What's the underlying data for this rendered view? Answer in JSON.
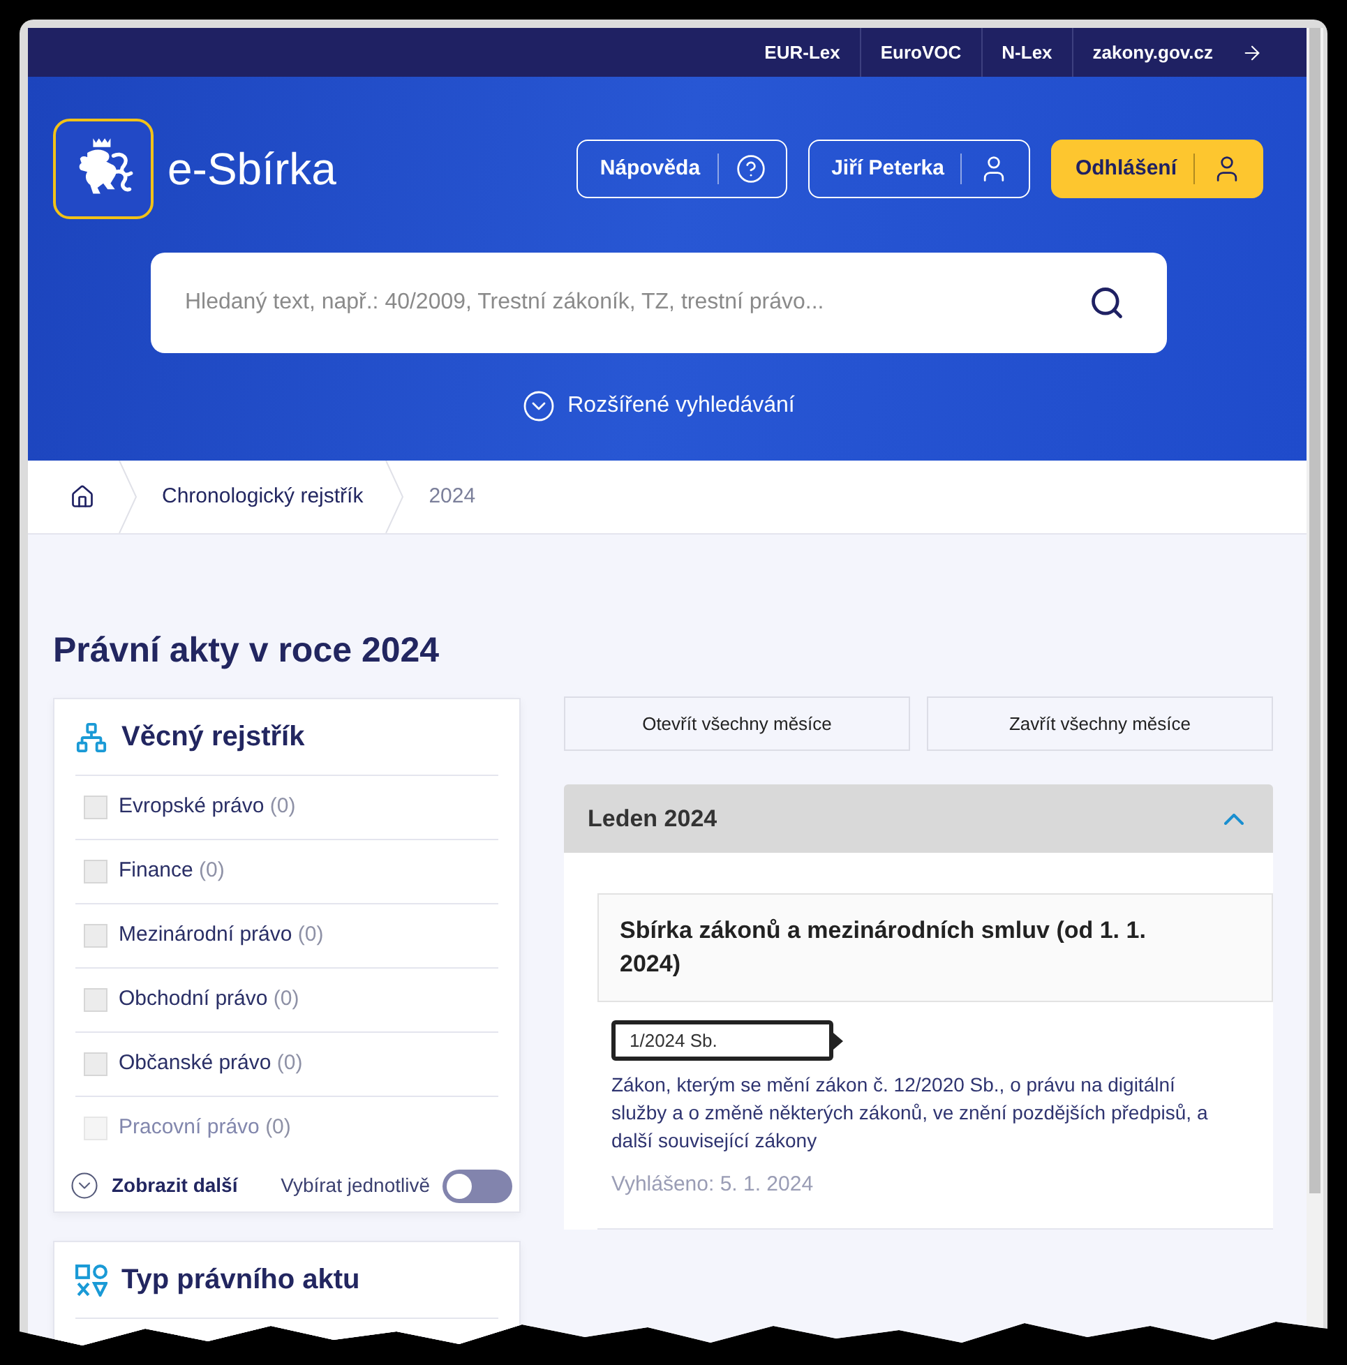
{
  "top_links": [
    {
      "label": "EUR-Lex"
    },
    {
      "label": "EuroVOC"
    },
    {
      "label": "N-Lex"
    },
    {
      "label": "zakony.gov.cz"
    }
  ],
  "header": {
    "logo_text": "e-Sbírka",
    "buttons": [
      {
        "label": "Nápověda",
        "kind": "help"
      },
      {
        "label": "Jiří Peterka",
        "kind": "user"
      },
      {
        "label": "Odhlášení",
        "kind": "logout"
      }
    ]
  },
  "search": {
    "placeholder": "Hledaný text, např.: 40/2009, Trestní zákoník, TZ, trestní právo..."
  },
  "advanced_search": {
    "label": "Rozšířené vyhledávání"
  },
  "breadcrumb": [
    {
      "label": "Chronologický rejstřík",
      "current": false
    },
    {
      "label": "2024",
      "current": true
    }
  ],
  "page_title": "Právní akty v roce 2024",
  "filters": [
    {
      "kind": "subject",
      "title": "Věcný rejstřík",
      "items": [
        {
          "label": "Evropské právo",
          "count": "(0)",
          "checked": false,
          "dimmed": false
        },
        {
          "label": "Finance",
          "count": "(0)",
          "checked": false,
          "dimmed": false
        },
        {
          "label": "Mezinárodní právo",
          "count": "(0)",
          "checked": false,
          "dimmed": false
        },
        {
          "label": "Obchodní právo",
          "count": "(0)",
          "checked": false,
          "dimmed": false
        },
        {
          "label": "Občanské právo",
          "count": "(0)",
          "checked": false,
          "dimmed": false
        },
        {
          "label": "Pracovní právo",
          "count": "(0)",
          "checked": false,
          "dimmed": true
        }
      ],
      "show_more": "Zobrazit další",
      "toggle": {
        "label": "Vybírat jednotlivě",
        "on": false
      }
    },
    {
      "kind": "type",
      "title": "Typ právního aktu"
    }
  ],
  "month_actions": [
    {
      "label": "Otevřít všechny měsíce"
    },
    {
      "label": "Zavřít všechny měsíce"
    }
  ],
  "months": [
    {
      "title": "Leden 2024",
      "expanded": true,
      "sections": [
        {
          "title": "Sbírka zákonů a mezinárodních smluv (od 1. 1. 2024)",
          "acts": [
            {
              "number": "1/2024 Sb.",
              "title": "Zákon, kterým se mění zákon č. 12/2020 Sb., o právu na digitální služby a o změně některých zákonů, ve znění pozdějších předpisů, a další související zákony",
              "announced": "Vyhlášeno: 5. 1. 2024"
            }
          ]
        }
      ]
    }
  ]
}
